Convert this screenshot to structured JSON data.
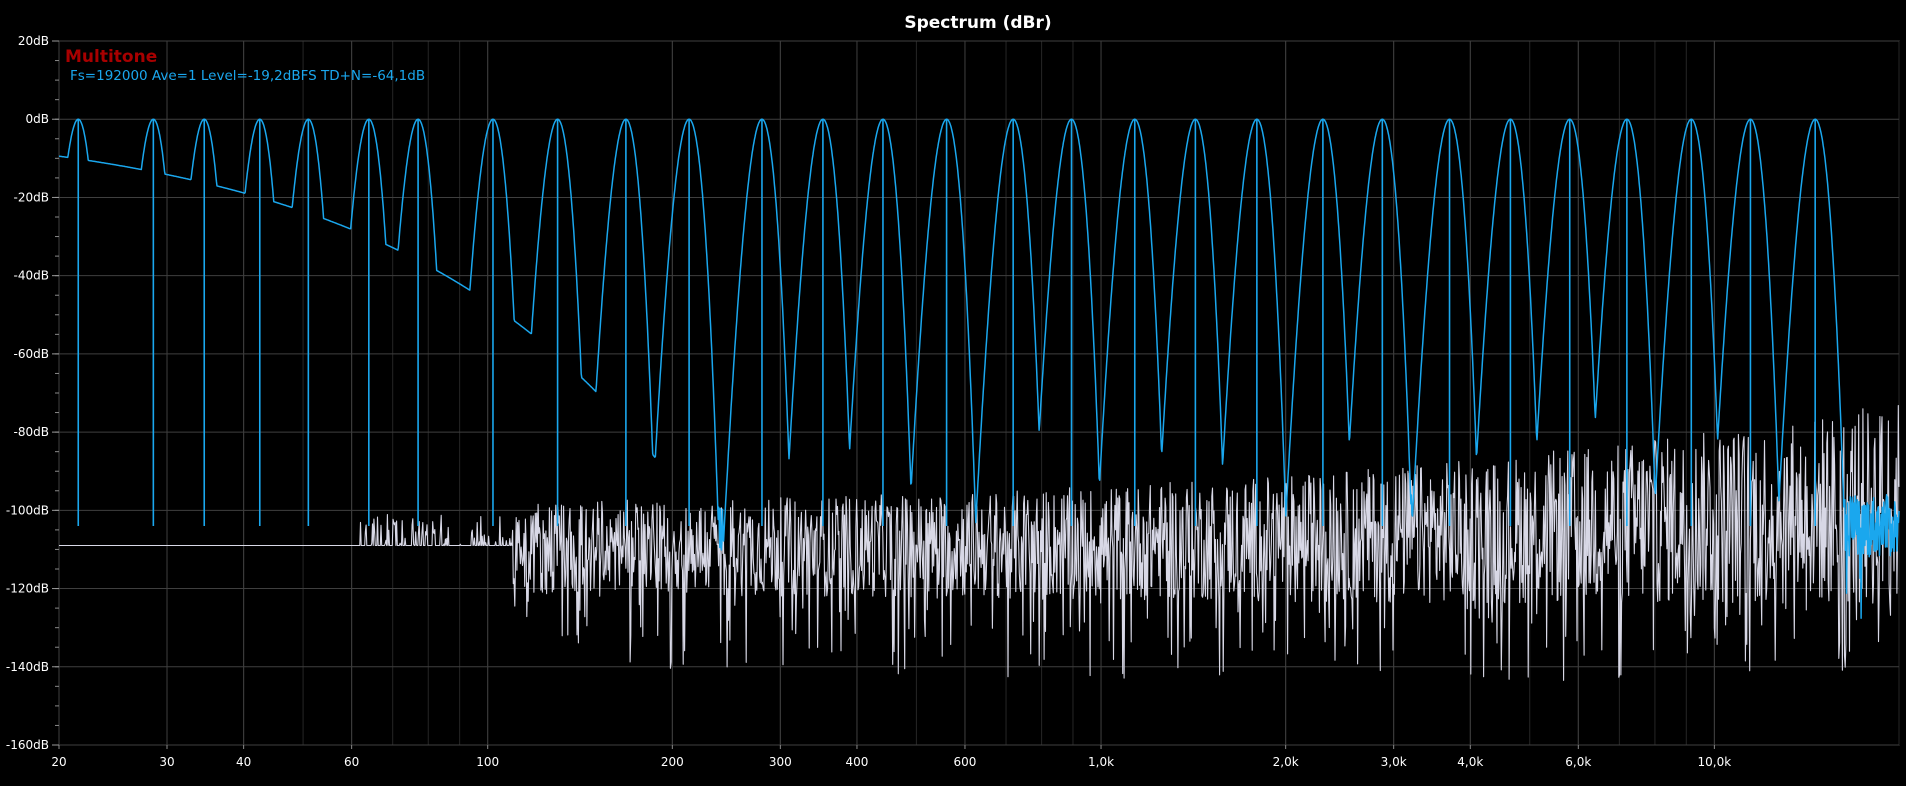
{
  "chart_data": {
    "type": "line",
    "title": "Spectrum (dBr)",
    "xlabel": "",
    "ylabel": "",
    "x_scale": "log",
    "xlim": [
      20,
      20000
    ],
    "ylim": [
      -160,
      20
    ],
    "grid": true,
    "x_tick_values": [
      20,
      30,
      40,
      60,
      100,
      200,
      300,
      400,
      600,
      1000,
      2000,
      3000,
      4000,
      6000,
      10000
    ],
    "x_tick_labels": [
      "20",
      "30",
      "40",
      "60",
      "100",
      "200",
      "300",
      "400",
      "600",
      "1,0k",
      "2,0k",
      "3,0k",
      "4,0k",
      "6,0k",
      "10,0k"
    ],
    "y_tick_values": [
      20,
      0,
      -20,
      -40,
      -60,
      -80,
      -100,
      -120,
      -140,
      -160
    ],
    "y_tick_labels": [
      "20dB",
      "0dB",
      "-20dB",
      "-40dB",
      "-60dB",
      "-80dB",
      "-100dB",
      "-120dB",
      "-140dB",
      "-160dB"
    ],
    "annotation_title": "Multitone",
    "annotation_text": "Fs=192000  Ave=1  Level=-19,2dBFS  TD+N=-64,1dB",
    "tone_frequencies": [
      21.5,
      28.5,
      34.5,
      42.5,
      51,
      64,
      77,
      102,
      130,
      168,
      213,
      280,
      352,
      441,
      560,
      719,
      895,
      1135,
      1425,
      1795,
      2300,
      2875,
      3700,
      4650,
      5810,
      7200,
      9170,
      11450,
      14600
    ],
    "series": [
      {
        "name": "",
        "color": "#d8d8e6",
        "role": "distortion-noise",
        "floor_db": -109,
        "noise_upper_start_db": -98,
        "noise_upper_end_db": -72,
        "noise_lower_start_db": -120,
        "noise_lower_end_db": -125
      },
      {
        "name": "",
        "color": "#1aa7ee",
        "role": "multitone-spectrum",
        "tone_level_db": 0,
        "floor_db": -104
      }
    ]
  }
}
